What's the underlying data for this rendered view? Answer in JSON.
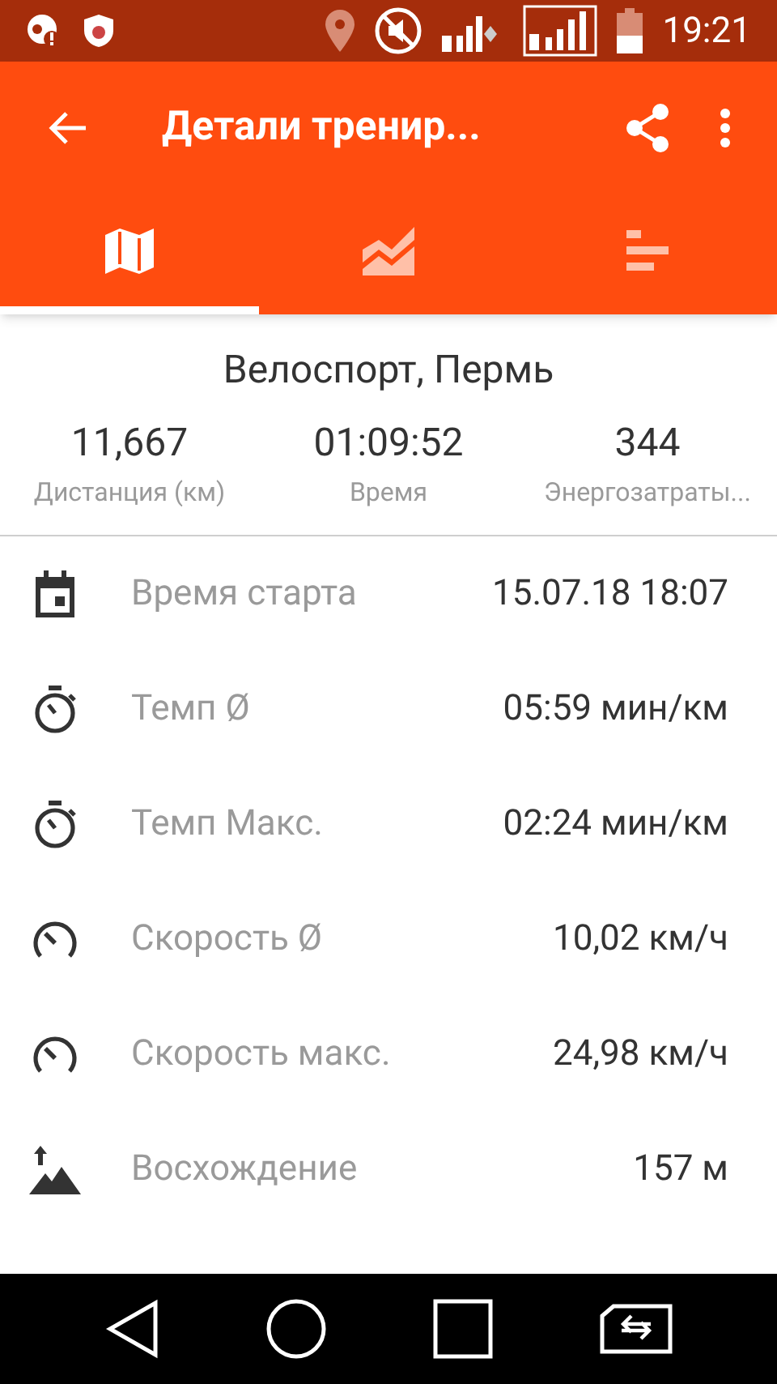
{
  "status_bar": {
    "time": "19:21"
  },
  "toolbar": {
    "title": "Детали тренир..."
  },
  "tabs": [
    {
      "kind": "map",
      "selected": true
    },
    {
      "kind": "chart",
      "selected": false
    },
    {
      "kind": "bars",
      "selected": false
    }
  ],
  "summary": {
    "title": "Велоспорт, Пермь",
    "stats": [
      {
        "value": "11,667",
        "label": "Дистанция (км)"
      },
      {
        "value": "01:09:52",
        "label": "Время"
      },
      {
        "value": "344",
        "label": "Энергозатраты..."
      }
    ]
  },
  "rows": [
    {
      "kind": "calendar",
      "label": "Время старта",
      "value": "15.07.18 18:07"
    },
    {
      "kind": "stopwatch",
      "label": "Темп Ø",
      "value": "05:59 мин/км"
    },
    {
      "kind": "stopwatch",
      "label": "Темп Макс.",
      "value": "02:24 мин/км"
    },
    {
      "kind": "speedometer",
      "label": "Скорость Ø",
      "value": "10,02 км/ч"
    },
    {
      "kind": "speedometer",
      "label": "Скорость макс.",
      "value": "24,98 км/ч"
    },
    {
      "kind": "ascent",
      "label": "Восхождение",
      "value": "157 м"
    }
  ]
}
